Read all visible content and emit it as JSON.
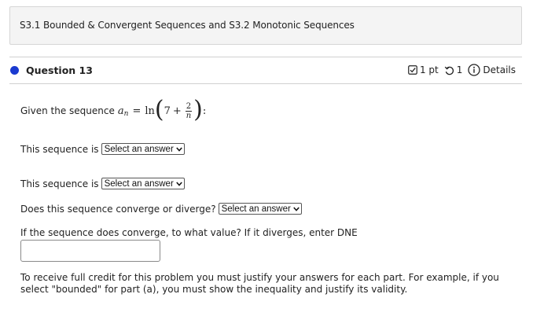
{
  "header": {
    "title": "S3.1 Bounded & Convergent Sequences and S3.2 Monotonic Sequences"
  },
  "question": {
    "title": "Question 13",
    "points": "1 pt",
    "attempts": "1",
    "details_label": "Details",
    "prompt_prefix": "Given the sequence",
    "sequence": {
      "symbol": "a",
      "subscript": "n",
      "equals": "=",
      "func": "ln",
      "constant": "7",
      "plus": "+",
      "frac_num": "2",
      "frac_den": "n",
      "trailing": ":"
    },
    "part1_label": "This sequence is",
    "part1_select": "Select an answer",
    "part2_label": "This sequence is",
    "part2_select": "Select an answer",
    "part3_label": "Does this sequence converge or diverge?",
    "part3_select": "Select an answer",
    "part4_label": "If the sequence does converge, to what value? If it diverges, enter DNE",
    "part4_value": "",
    "note": "To receive full credit for this problem you must justify your answers for each part.  For example, if you select \"bounded\" for part (a), you must show the inequality and justify its validity."
  },
  "colors": {
    "accent_dot": "#1a3ad0",
    "header_bg": "#f4f4f4"
  },
  "icons": {
    "points": "checkbox-icon",
    "attempts": "retry-icon",
    "details": "info-icon",
    "select": "chevron-down-icon"
  }
}
